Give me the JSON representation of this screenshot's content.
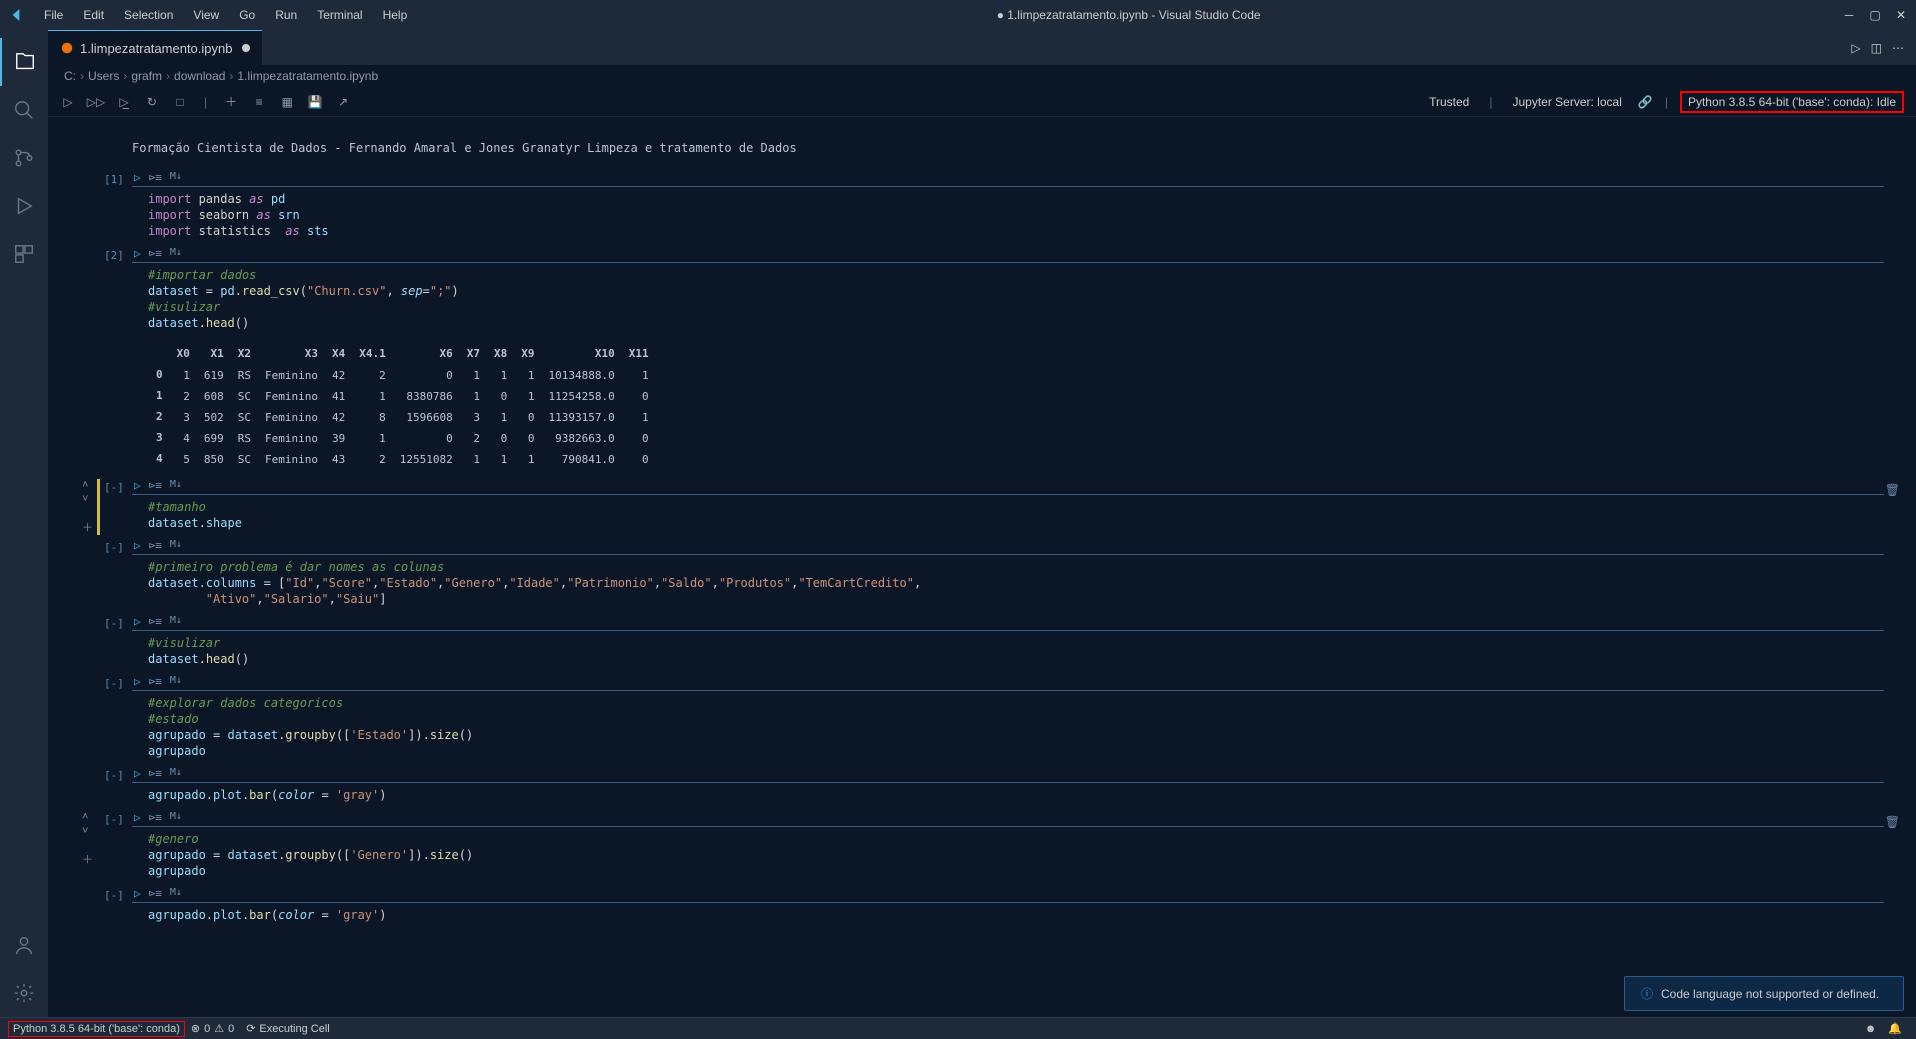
{
  "titlebar": {
    "menus": [
      "File",
      "Edit",
      "Selection",
      "View",
      "Go",
      "Run",
      "Terminal",
      "Help"
    ],
    "title": "● 1.limpezatratamento.ipynb - Visual Studio Code"
  },
  "tab": {
    "name": "1.limpezatratamento.ipynb"
  },
  "breadcrumbs": [
    "C:",
    "Users",
    "grafm",
    "download",
    "1.limpezatratamento.ipynb"
  ],
  "toolbar_right": {
    "trusted": "Trusted",
    "jupyter": "Jupyter Server: local",
    "kernel": "Python 3.8.5 64-bit ('base': conda): Idle"
  },
  "markdown": "Formação Cientista de Dados - Fernando Amaral e Jones Granatyr Limpeza e tratamento de Dados",
  "cells": {
    "c1": {
      "prompt": "[1]"
    },
    "c2": {
      "prompt": "[2]"
    },
    "c3": {
      "prompt": "[-]"
    },
    "c4": {
      "prompt": "[-]"
    },
    "c5": {
      "prompt": "[-]"
    },
    "c6": {
      "prompt": "[-]"
    },
    "c7": {
      "prompt": "[-]"
    },
    "c8": {
      "prompt": "[-]"
    },
    "c9": {
      "prompt": "[-]"
    }
  },
  "cell_toolbar_mark": "M↓",
  "data_table": {
    "headers": [
      "",
      "X0",
      "X1",
      "X2",
      "X3",
      "X4",
      "X4.1",
      "X6",
      "X7",
      "X8",
      "X9",
      "X10",
      "X11"
    ],
    "rows": [
      [
        "0",
        "1",
        "619",
        "RS",
        "Feminino",
        "42",
        "2",
        "0",
        "1",
        "1",
        "1",
        "10134888.0",
        "1"
      ],
      [
        "1",
        "2",
        "608",
        "SC",
        "Feminino",
        "41",
        "1",
        "8380786",
        "1",
        "0",
        "1",
        "11254258.0",
        "0"
      ],
      [
        "2",
        "3",
        "502",
        "SC",
        "Feminino",
        "42",
        "8",
        "1596608",
        "3",
        "1",
        "0",
        "11393157.0",
        "1"
      ],
      [
        "3",
        "4",
        "699",
        "RS",
        "Feminino",
        "39",
        "1",
        "0",
        "2",
        "0",
        "0",
        "9382663.0",
        "0"
      ],
      [
        "4",
        "5",
        "850",
        "SC",
        "Feminino",
        "43",
        "2",
        "12551082",
        "1",
        "1",
        "1",
        "790841.0",
        "0"
      ]
    ]
  },
  "notification": "Code language not supported or defined.",
  "statusbar": {
    "kernel": "Python 3.8.5 64-bit ('base': conda)",
    "errors": "0",
    "warnings": "0",
    "executing": "Executing Cell"
  }
}
